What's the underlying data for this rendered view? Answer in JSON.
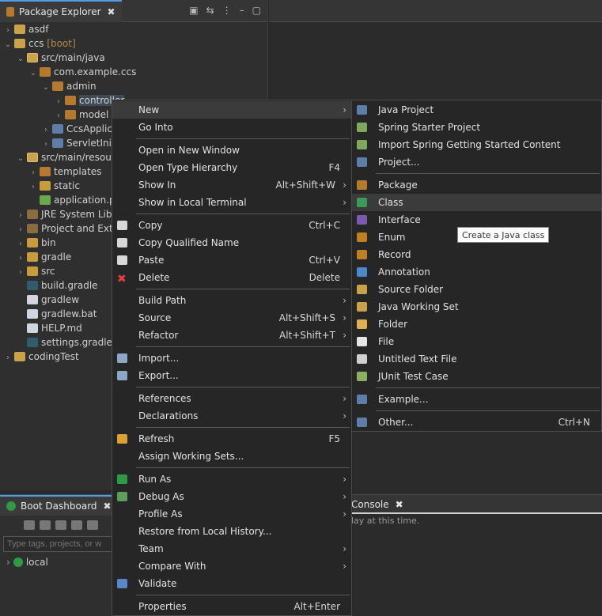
{
  "package_explorer": {
    "title": "Package Explorer",
    "close": "✖",
    "actions": [
      "▣",
      "⇆",
      "⋮",
      "–",
      "▢"
    ]
  },
  "tree": [
    {
      "label": "asdf",
      "indent": 0,
      "twisty": "›",
      "icon": "project-icon"
    },
    {
      "label": "ccs",
      "suffix": " [boot]",
      "indent": 0,
      "twisty": "⌄",
      "icon": "project-icon"
    },
    {
      "label": "src/main/java",
      "indent": 1,
      "twisty": "⌄",
      "icon": "source-folder-icon"
    },
    {
      "label": "com.example.ccs",
      "indent": 2,
      "twisty": "⌄",
      "icon": "package-icon"
    },
    {
      "label": "admin",
      "indent": 3,
      "twisty": "⌄",
      "icon": "package-icon"
    },
    {
      "label": "controller",
      "indent": 4,
      "twisty": "›",
      "icon": "package-icon",
      "selected": true
    },
    {
      "label": "model",
      "indent": 4,
      "twisty": "›",
      "icon": "package-icon"
    },
    {
      "label": "CcsApplic",
      "indent": 3,
      "twisty": "›",
      "icon": "java-file-icon"
    },
    {
      "label": "ServletInit",
      "indent": 3,
      "twisty": "›",
      "icon": "java-file-icon"
    },
    {
      "label": "src/main/resour",
      "indent": 1,
      "twisty": "⌄",
      "icon": "source-folder-icon"
    },
    {
      "label": "templates",
      "indent": 2,
      "twisty": "›",
      "icon": "package-icon"
    },
    {
      "label": "static",
      "indent": 2,
      "twisty": "›",
      "icon": "folder-icon"
    },
    {
      "label": "application.p",
      "indent": 2,
      "twisty": "",
      "icon": "spring-leaf-icon"
    },
    {
      "label": "JRE System Libr",
      "indent": 1,
      "twisty": "›",
      "icon": "library-icon"
    },
    {
      "label": "Project and Exte",
      "indent": 1,
      "twisty": "›",
      "icon": "library-icon"
    },
    {
      "label": "bin",
      "indent": 1,
      "twisty": "›",
      "icon": "folder-icon"
    },
    {
      "label": "gradle",
      "indent": 1,
      "twisty": "›",
      "icon": "folder-icon"
    },
    {
      "label": "src",
      "indent": 1,
      "twisty": "›",
      "icon": "folder-icon"
    },
    {
      "label": "build.gradle",
      "indent": 1,
      "twisty": "",
      "icon": "gradle-icon"
    },
    {
      "label": "gradlew",
      "indent": 1,
      "twisty": "",
      "icon": "file-icon"
    },
    {
      "label": "gradlew.bat",
      "indent": 1,
      "twisty": "",
      "icon": "file-icon"
    },
    {
      "label": "HELP.md",
      "indent": 1,
      "twisty": "",
      "icon": "file-icon"
    },
    {
      "label": "settings.gradle",
      "indent": 1,
      "twisty": "",
      "icon": "gradle-icon"
    },
    {
      "label": "codingTest",
      "indent": 0,
      "twisty": "›",
      "icon": "project-icon"
    }
  ],
  "boot_dashboard": {
    "title": "Boot Dashboard",
    "close": "✖",
    "filter_placeholder": "Type tags, projects, or w",
    "local_label": "local",
    "twisty": "›"
  },
  "console": {
    "title": "Console",
    "close": "✖",
    "message": "lay at this time."
  },
  "context_menu": [
    {
      "label": "New",
      "submenu": true,
      "highlight": true
    },
    {
      "label": "Go Into"
    },
    {
      "sep": true
    },
    {
      "label": "Open in New Window"
    },
    {
      "label": "Open Type Hierarchy",
      "accel": "F4"
    },
    {
      "label": "Show In",
      "accel": "Alt+Shift+W",
      "submenu": true
    },
    {
      "label": "Show in Local Terminal",
      "submenu": true
    },
    {
      "sep": true
    },
    {
      "label": "Copy",
      "accel": "Ctrl+C",
      "icon": "copy-icon"
    },
    {
      "label": "Copy Qualified Name",
      "icon": "copy-icon"
    },
    {
      "label": "Paste",
      "accel": "Ctrl+V",
      "icon": "paste-icon"
    },
    {
      "label": "Delete",
      "accel": "Delete",
      "icon": "delete-icon"
    },
    {
      "sep": true
    },
    {
      "label": "Build Path",
      "submenu": true
    },
    {
      "label": "Source",
      "accel": "Alt+Shift+S",
      "submenu": true
    },
    {
      "label": "Refactor",
      "accel": "Alt+Shift+T",
      "submenu": true
    },
    {
      "sep": true
    },
    {
      "label": "Import...",
      "icon": "import-icon"
    },
    {
      "label": "Export...",
      "icon": "export-icon"
    },
    {
      "sep": true
    },
    {
      "label": "References",
      "submenu": true
    },
    {
      "label": "Declarations",
      "submenu": true
    },
    {
      "sep": true
    },
    {
      "label": "Refresh",
      "accel": "F5",
      "icon": "refresh-icon"
    },
    {
      "label": "Assign Working Sets..."
    },
    {
      "sep": true
    },
    {
      "label": "Run As",
      "submenu": true,
      "icon": "run-icon"
    },
    {
      "label": "Debug As",
      "submenu": true,
      "icon": "debug-icon"
    },
    {
      "label": "Profile As",
      "submenu": true
    },
    {
      "label": "Restore from Local History..."
    },
    {
      "label": "Team",
      "submenu": true
    },
    {
      "label": "Compare With",
      "submenu": true
    },
    {
      "label": "Validate",
      "icon": "validate-icon"
    },
    {
      "sep": true
    },
    {
      "label": "Properties",
      "accel": "Alt+Enter"
    }
  ],
  "new_submenu": [
    {
      "label": "Java Project",
      "icon": "java-project-icon"
    },
    {
      "label": "Spring Starter Project",
      "icon": "spring-project-icon"
    },
    {
      "label": "Import Spring Getting Started Content",
      "icon": "spring-import-icon"
    },
    {
      "label": "Project...",
      "icon": "project-wizard-icon"
    },
    {
      "sep": true
    },
    {
      "label": "Package",
      "icon": "package-icon"
    },
    {
      "label": "Class",
      "icon": "class-icon",
      "highlight": true
    },
    {
      "label": "Interface",
      "icon": "interface-icon"
    },
    {
      "label": "Enum",
      "icon": "enum-icon"
    },
    {
      "label": "Record",
      "icon": "record-icon"
    },
    {
      "label": "Annotation",
      "icon": "annotation-icon"
    },
    {
      "label": "Source Folder",
      "icon": "source-folder-icon"
    },
    {
      "label": "Java Working Set",
      "icon": "working-set-icon"
    },
    {
      "label": "Folder",
      "icon": "folder-icon"
    },
    {
      "label": "File",
      "icon": "file-icon"
    },
    {
      "label": "Untitled Text File",
      "icon": "text-file-icon"
    },
    {
      "label": "JUnit Test Case",
      "icon": "junit-icon"
    },
    {
      "sep": true
    },
    {
      "label": "Example...",
      "icon": "example-icon"
    },
    {
      "sep": true
    },
    {
      "label": "Other...",
      "accel": "Ctrl+N",
      "icon": "other-wizard-icon"
    }
  ],
  "tooltip": "Create a Java class",
  "colors": {
    "accent": "#4f9ee3",
    "background": "#2b2b2b",
    "menu": "#262626"
  }
}
